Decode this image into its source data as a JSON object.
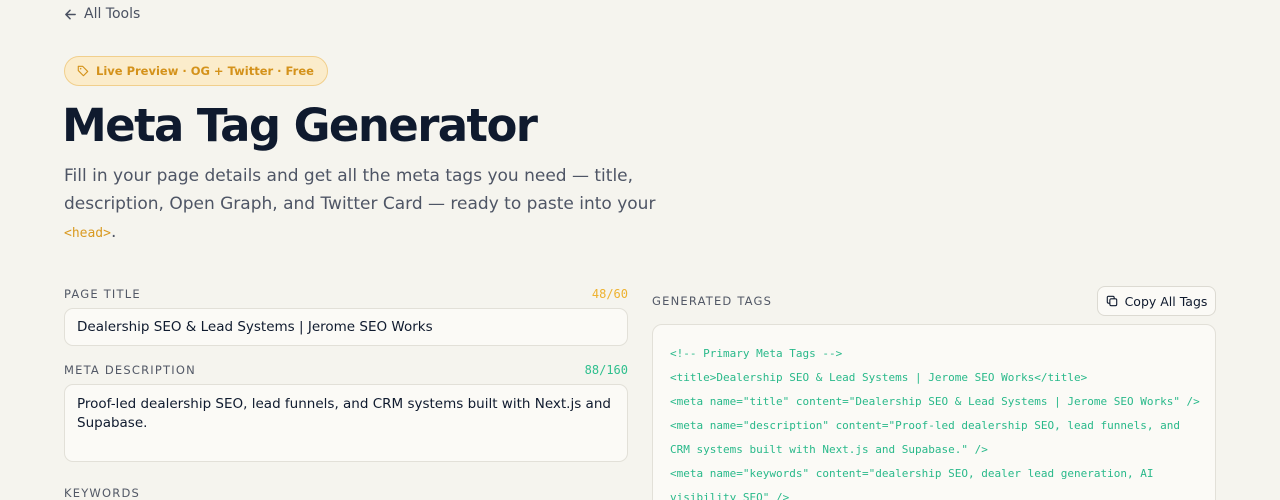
{
  "nav": {
    "back_label": "All Tools"
  },
  "badge": {
    "label": "Live Preview · OG + Twitter · Free"
  },
  "header": {
    "title": "Meta Tag Generator",
    "lead_text": "Fill in your page details and get all the meta tags you need — title, description, Open Graph, and Twitter Card — ready to paste into your ",
    "lead_code": "<head>",
    "lead_end": "."
  },
  "form": {
    "page_title": {
      "label": "PAGE TITLE",
      "counter": "48/60",
      "counter_color": "#eeb230",
      "value": "Dealership SEO & Lead Systems | Jerome SEO Works"
    },
    "meta_description": {
      "label": "META DESCRIPTION",
      "counter": "88/160",
      "counter_color": "#2fbf8e",
      "value": "Proof-led dealership SEO, lead funnels, and CRM systems built with Next.js and Supabase."
    },
    "keywords": {
      "label": "KEYWORDS"
    }
  },
  "output": {
    "label": "GENERATED TAGS",
    "copy_label": "Copy All Tags",
    "lines": [
      "<!-- Primary Meta Tags -->",
      "<title>Dealership SEO & Lead Systems | Jerome SEO Works</title>",
      "<meta name=\"title\" content=\"Dealership SEO & Lead Systems | Jerome SEO Works\" />",
      "<meta name=\"description\" content=\"Proof-led dealership SEO, lead funnels, and",
      "CRM systems built with Next.js and Supabase.\" />",
      "<meta name=\"keywords\" content=\"dealership SEO, dealer lead generation, AI",
      "visibility SEO\" />"
    ]
  },
  "colors": {
    "accent": "#d99a22",
    "code_green": "#29b98a",
    "background": "#f5f4ee"
  }
}
